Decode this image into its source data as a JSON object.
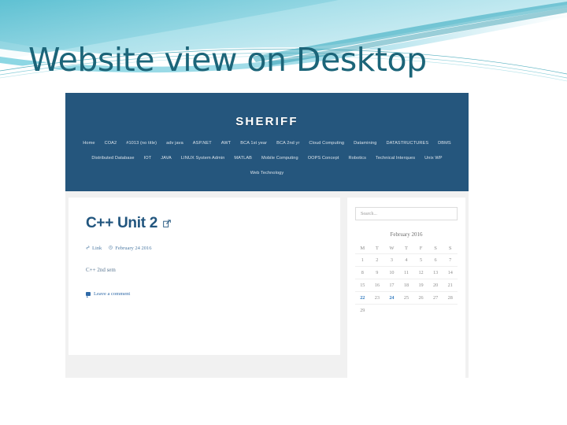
{
  "slide": {
    "title": "Website view on Desktop",
    "title_color": "#1c6579",
    "background": "#ffffff",
    "banner_colors": {
      "teal_dark": "#1b8a9c",
      "teal_mid": "#6fcbd8",
      "teal_light": "#a8e2ea",
      "sky": "#bfe6f0",
      "white": "#ffffff"
    }
  },
  "screenshot": {
    "site": {
      "brand": "SHERIFF",
      "header_color": "#25567d",
      "nav_rows": [
        [
          "Home",
          "COA2",
          "#1013 (no title)",
          "adv java",
          "ASP.NET",
          "AWT",
          "BCA 1st year",
          "BCA 2nd yr",
          "Cloud Computing",
          "Datamining",
          "DATASTRUCTURES",
          "DBMS"
        ],
        [
          "Distributed Database",
          "IOT",
          "JAVA",
          "LINUX System Admin",
          "MATLAB",
          "Mobile Computing",
          "OOPS Concept",
          "Robotics",
          "Technical Interques",
          "Unix WP"
        ],
        [
          "Web Technology"
        ]
      ]
    },
    "post": {
      "title": "C++ Unit 2",
      "title_icon": "external-link-icon",
      "meta": {
        "link_icon": "link-icon",
        "link_label": "Link",
        "date_icon": "clock-icon",
        "date_label": "February 24 2016"
      },
      "body": "C++ 2nd sem",
      "comment_icon": "comment-bubble-icon",
      "comment_label": "Leave a comment"
    },
    "sidebar": {
      "search": {
        "placeholder": "Search...",
        "value": ""
      },
      "calendar": {
        "caption": "February 2016",
        "day_headers": [
          "M",
          "T",
          "W",
          "T",
          "F",
          "S",
          "S"
        ],
        "weeks": [
          [
            "1",
            "2",
            "3",
            "4",
            "5",
            "6",
            "7"
          ],
          [
            "8",
            "9",
            "10",
            "11",
            "12",
            "13",
            "14"
          ],
          [
            "15",
            "16",
            "17",
            "18",
            "19",
            "20",
            "21"
          ],
          [
            "22",
            "23",
            "24",
            "25",
            "26",
            "27",
            "28"
          ],
          [
            "29",
            "",
            "",
            "",
            "",
            "",
            ""
          ]
        ],
        "highlighted": [
          "22",
          "24"
        ],
        "highlight_color": "#3a7fc1"
      }
    }
  }
}
